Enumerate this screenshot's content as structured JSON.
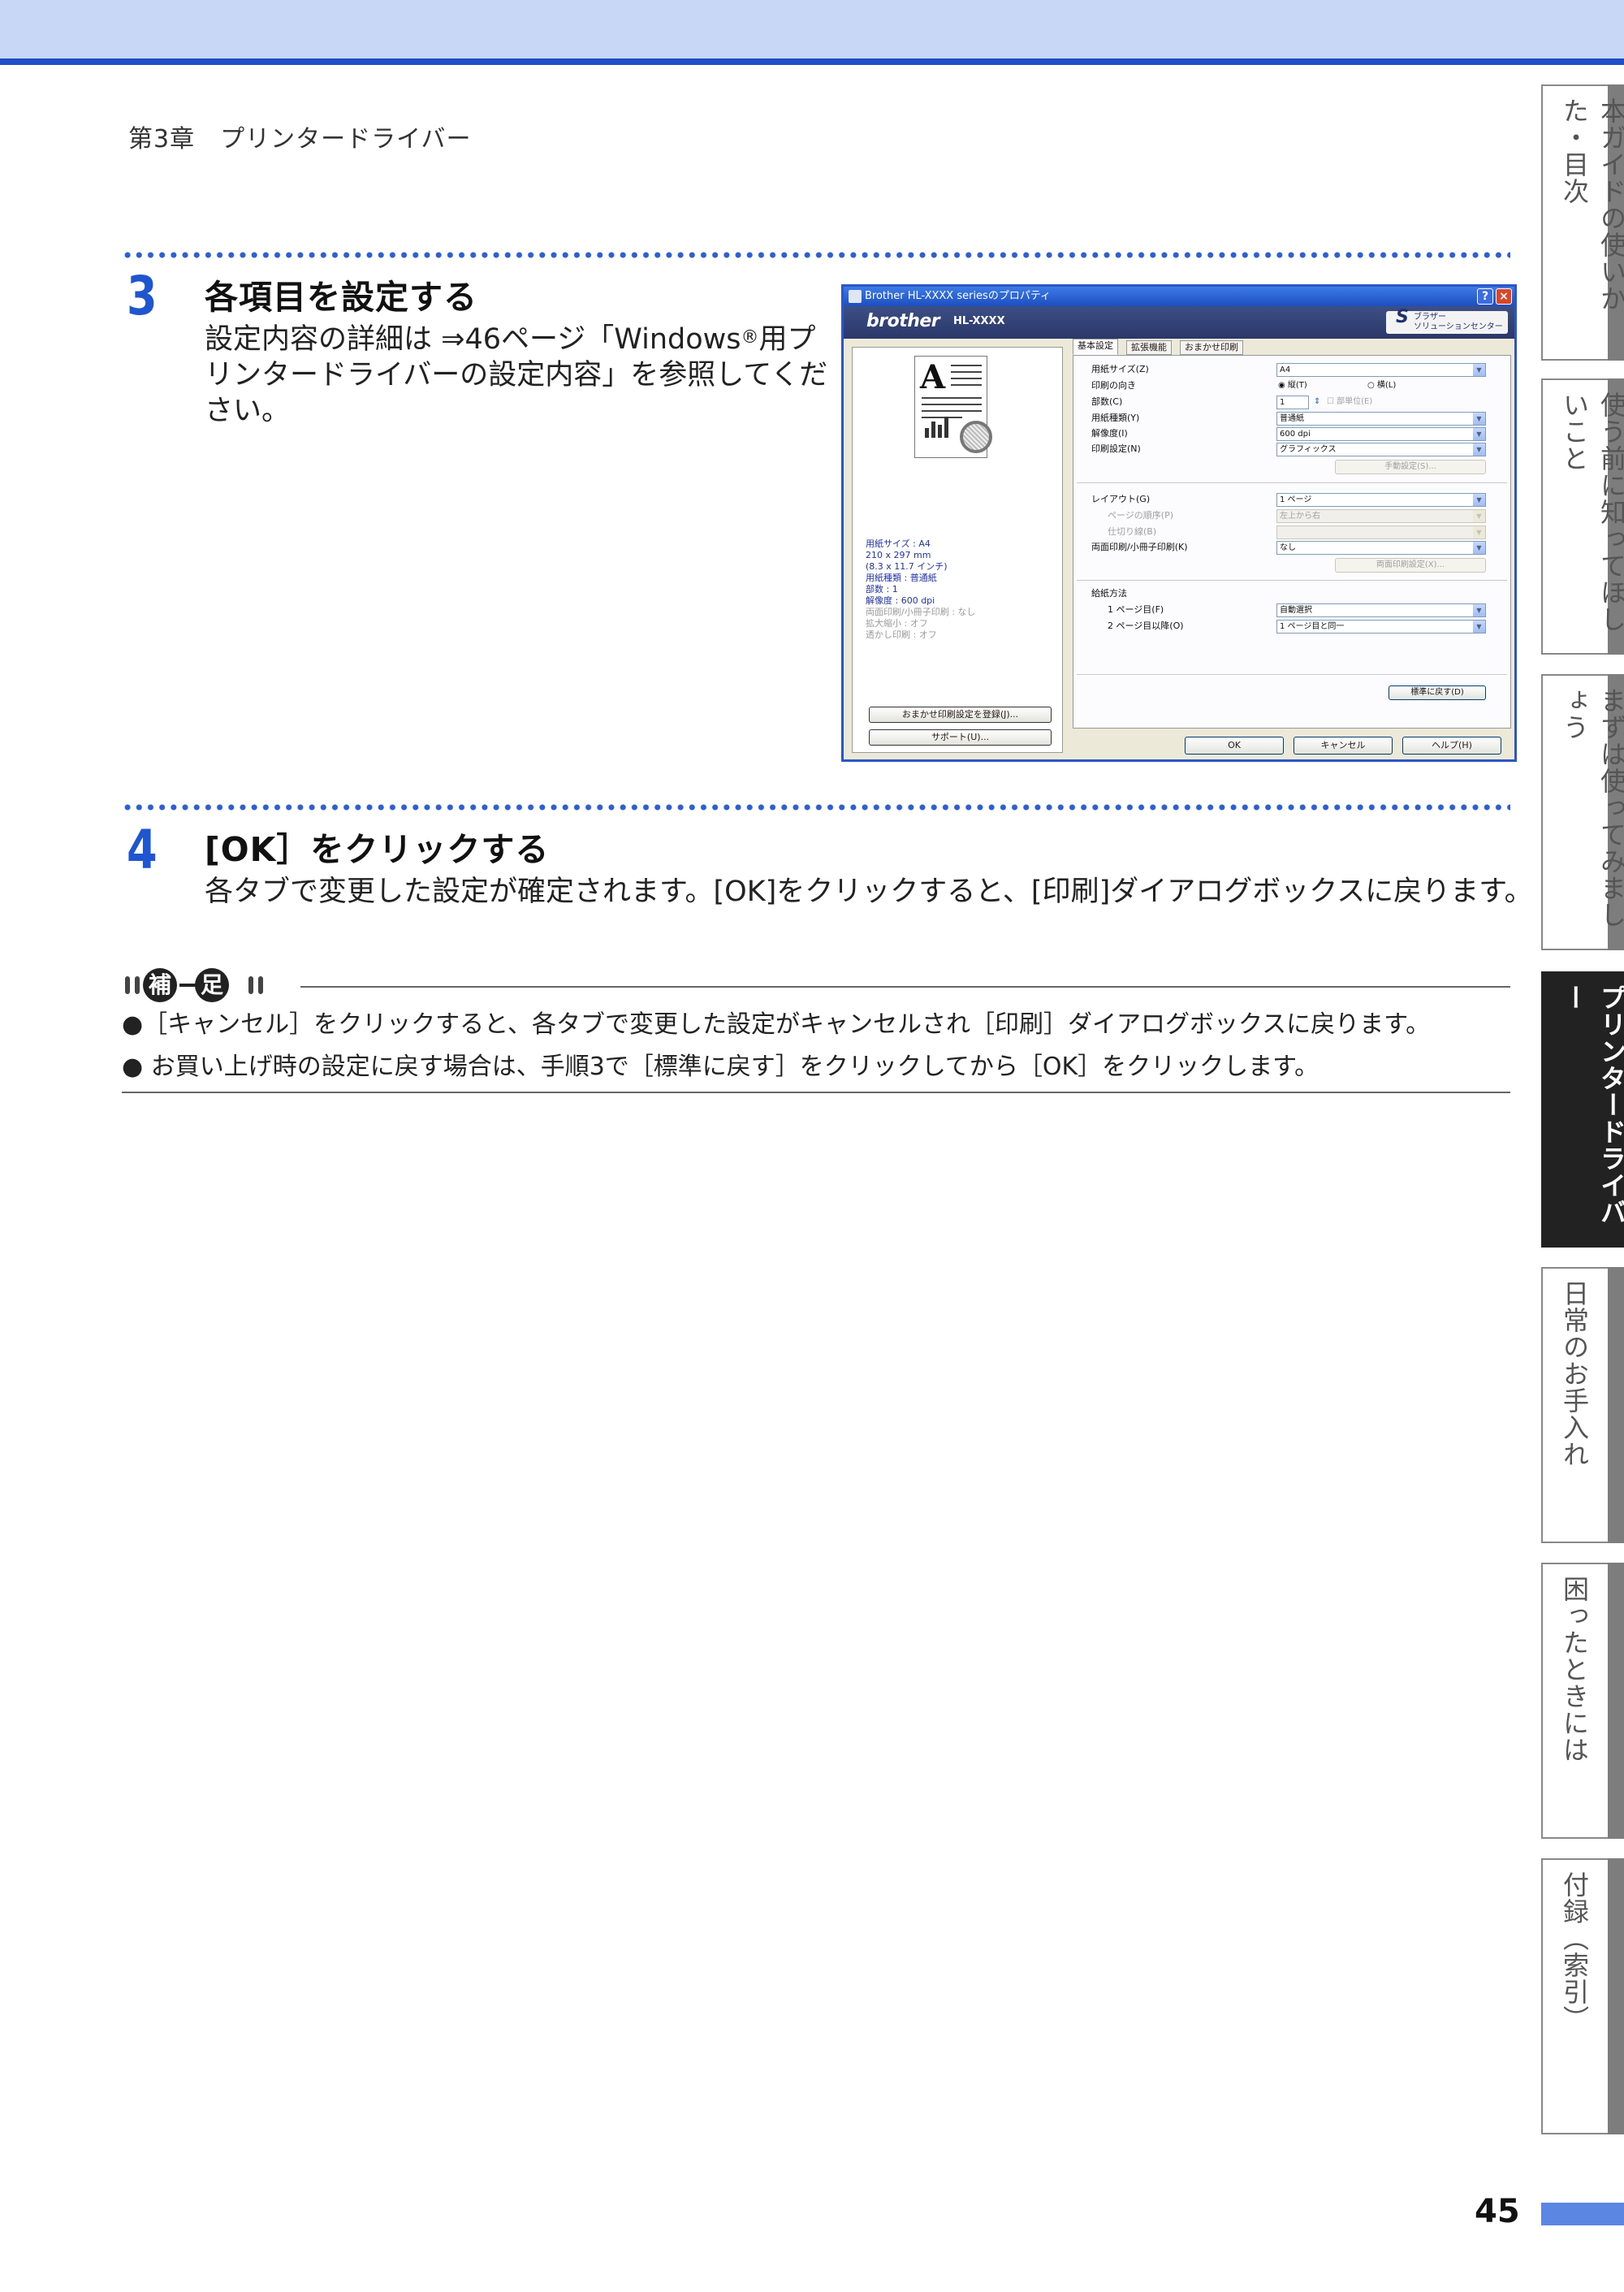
{
  "header": {
    "chapter": "第3章　プリンタードライバー"
  },
  "step3": {
    "number": "3",
    "title": "各項目を設定する",
    "body_line1": "設定内容の詳細は ⇒46ページ「Windows",
    "reg": "®",
    "body_line1b": "用プ",
    "body_line2": "リンタードライバーの設定内容」を参照してくだ",
    "body_line3": "さい。"
  },
  "dialog": {
    "title": "Brother HL-XXXX seriesのプロパティ",
    "brand": "brother",
    "model": "HL-XXXX",
    "solutions_line1": "ブラザー",
    "solutions_line2": "ソリューションセンター",
    "tabs": [
      "基本設定",
      "拡張機能",
      "おまかせ印刷"
    ],
    "summary": {
      "paper_size": "用紙サイズ : A4",
      "dims_mm": "210 x 297 mm",
      "dims_in": "(8.3 x 11.7 インチ)",
      "media": "用紙種類 : 普通紙",
      "copies": "部数 : 1",
      "resolution": "解像度 : 600 dpi",
      "duplex": "両面印刷/小冊子印刷 : なし",
      "scaling": "拡大縮小 : オフ",
      "watermark": "透かし印刷 : オフ"
    },
    "fields": {
      "paper_size_label": "用紙サイズ(Z)",
      "paper_size_value": "A4",
      "orientation_label": "印刷の向き",
      "portrait": "縦(T)",
      "landscape": "横(L)",
      "copies_label": "部数(C)",
      "copies_value": "1",
      "collate": "部単位(E)",
      "media_label": "用紙種類(Y)",
      "media_value": "普通紙",
      "resolution_label": "解像度(I)",
      "resolution_value": "600 dpi",
      "print_setting_label": "印刷設定(N)",
      "print_setting_value": "グラフィックス",
      "manual_btn": "手動設定(S)...",
      "layout_label": "レイアウト(G)",
      "layout_value": "1 ページ",
      "page_order_label": "ページの順序(P)",
      "page_order_value": "左上から右",
      "border_label": "仕切り線(B)",
      "duplex_label": "両面印刷/小冊子印刷(K)",
      "duplex_value": "なし",
      "duplex_btn": "両面印刷設定(X)...",
      "source_label": "給紙方法",
      "first_page_label": "1 ページ目(F)",
      "first_page_value": "自動選択",
      "other_pages_label": "2 ページ目以降(O)",
      "other_pages_value": "1 ページ目と同一",
      "default_btn": "標準に戻す(D)"
    },
    "left_buttons": [
      "おまかせ印刷設定を登録(J)...",
      "サポート(U)..."
    ],
    "buttons": [
      "OK",
      "キャンセル",
      "ヘルプ(H)"
    ]
  },
  "step4": {
    "number": "4",
    "title": "[OK］をクリックする",
    "body": "各タブで変更した設定が確定されます。[OK]をクリックすると、[印刷]ダイアログボックスに戻ります。"
  },
  "note": {
    "badge_chars": [
      "補",
      "足"
    ],
    "items": [
      "●［キャンセル］をクリックすると、各タブで変更した設定がキャンセルされ［印刷］ダイアログボックスに戻ります。",
      "● お買い上げ時の設定に戻す場合は、手順3で［標準に戻す］をクリックしてから［OK］をクリックします。"
    ]
  },
  "side_tabs": [
    {
      "label": "本ガイドの使いかた・目次",
      "active": false
    },
    {
      "label": "使う前に知ってほしいこと",
      "active": false
    },
    {
      "label": "まずは使ってみましょう",
      "active": false
    },
    {
      "label": "プリンタードライバー",
      "active": true
    },
    {
      "label": "日常のお手入れ",
      "active": false
    },
    {
      "label": "困ったときには",
      "active": false
    },
    {
      "label": "付録（索引）",
      "active": false
    }
  ],
  "page_number": "45",
  "colors": {
    "accent": "#1f56d0",
    "band": "#c9d7f7",
    "page_bar": "#5b86e2"
  }
}
